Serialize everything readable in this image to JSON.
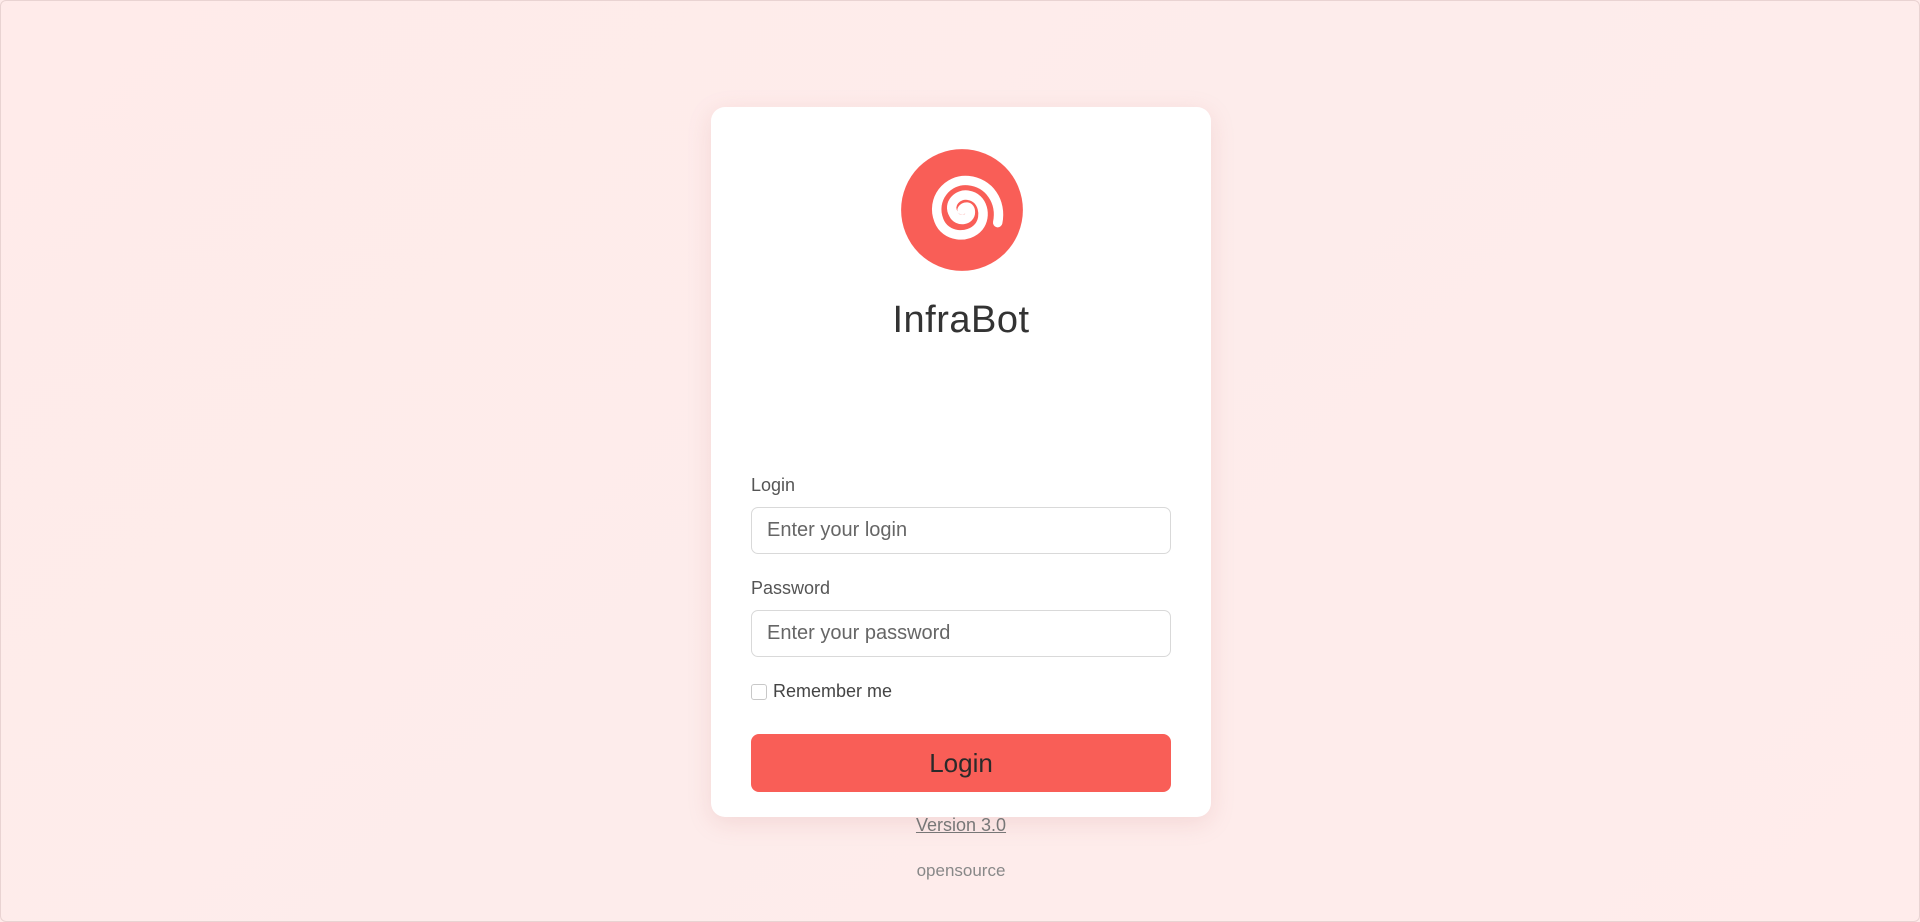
{
  "app": {
    "name": "InfraBot",
    "logo_icon": "spiral-icon",
    "accent_color": "#f95e57"
  },
  "form": {
    "login_label": "Login",
    "login_placeholder": "Enter your login",
    "login_value": "",
    "password_label": "Password",
    "password_placeholder": "Enter your password",
    "password_value": "",
    "remember_label": "Remember me",
    "remember_checked": false,
    "submit_label": "Login"
  },
  "footer": {
    "version_link": "Version 3.0",
    "license_text": "opensource"
  }
}
